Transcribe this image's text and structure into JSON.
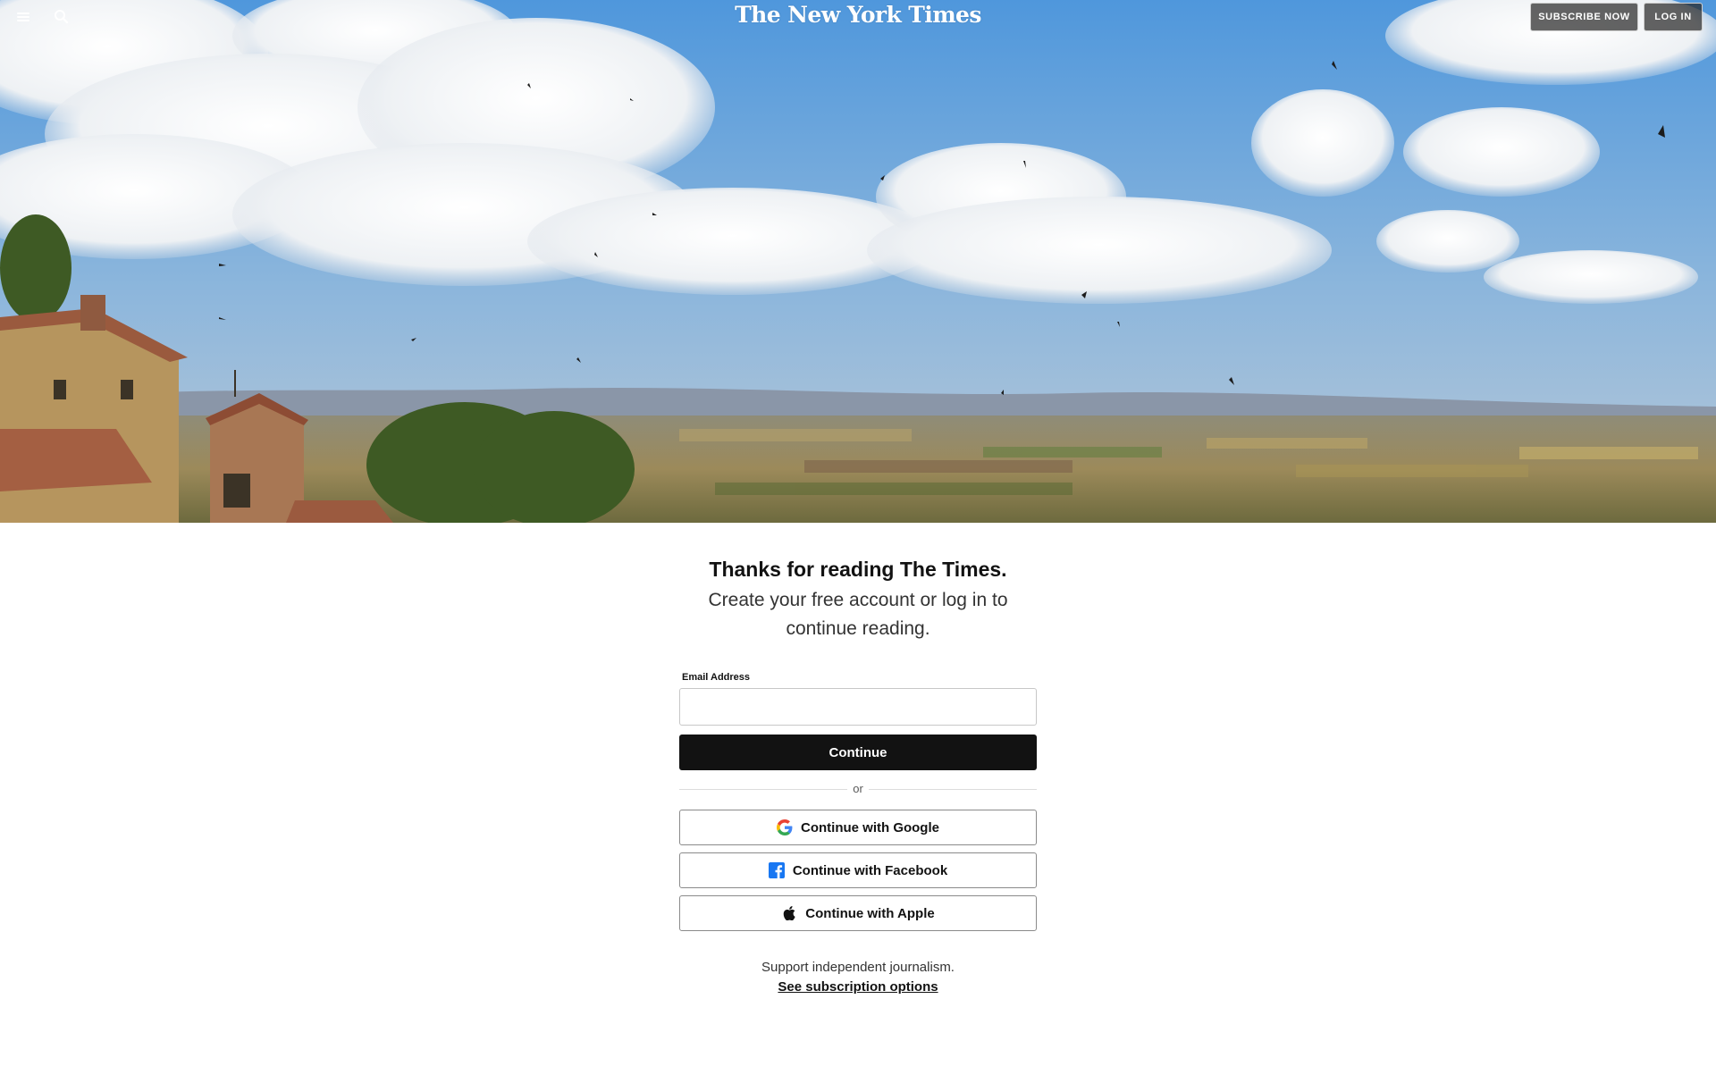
{
  "header": {
    "masthead": "The New York Times",
    "subscribe_label": "SUBSCRIBE NOW",
    "login_label": "LOG IN",
    "menu_icon": "hamburger-menu-icon",
    "search_icon": "search-icon"
  },
  "hero": {
    "description_icon": "landscape-photo"
  },
  "gate": {
    "headline": "Thanks for reading The Times.",
    "subhead": "Create your free account or log in to continue reading.",
    "email_label": "Email Address",
    "email_value": "",
    "email_placeholder": "",
    "continue_label": "Continue",
    "divider_text": "or",
    "google_label": "Continue with Google",
    "facebook_label": "Continue with Facebook",
    "apple_label": "Continue with Apple",
    "support_text": "Support independent journalism.",
    "subscription_link": "See subscription options"
  },
  "colors": {
    "primary_button": "#121212",
    "facebook_blue": "#1877f2",
    "google_blue": "#4285F4",
    "google_red": "#EA4335",
    "google_yellow": "#FBBC05",
    "google_green": "#34A853"
  }
}
